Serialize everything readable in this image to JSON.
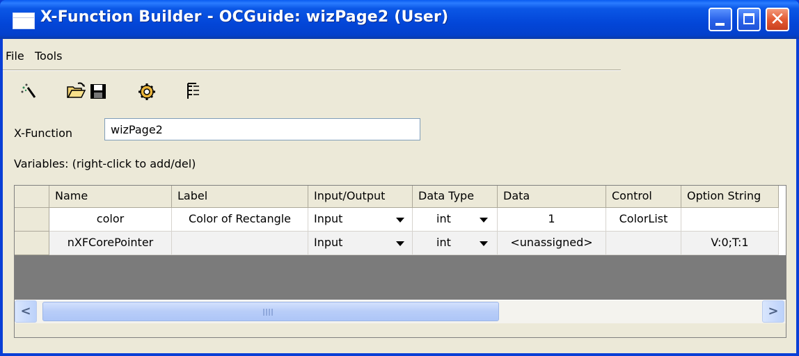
{
  "window": {
    "title": "X-Function Builder - OCGuide: wizPage2 (User)",
    "close_glyph": "✕"
  },
  "menu": {
    "items": [
      "File",
      "Tools"
    ]
  },
  "toolbar": {
    "buttons": [
      "new-wizard-icon",
      "open-folder-icon",
      "save-disk-icon",
      "settings-gear-icon",
      "tree-view-icon"
    ]
  },
  "xfunction": {
    "label": "X-Function",
    "value": "wizPage2"
  },
  "variables": {
    "label": "Variables: (right-click to add/del)"
  },
  "grid": {
    "headers": [
      "Name",
      "Label",
      "Input/Output",
      "Data Type",
      "Data",
      "Control",
      "Option String"
    ],
    "rows": [
      {
        "name": "color",
        "label": "Color of Rectangle",
        "io": "Input",
        "type": "int",
        "data": "1",
        "control": "ColorList",
        "option": ""
      },
      {
        "name": "nXFCorePointer",
        "label": "",
        "io": "Input",
        "type": "int",
        "data": "<unassigned>",
        "control": "",
        "option": "V:0;T:1"
      }
    ]
  },
  "scrollbar": {
    "left_arrow": "<",
    "right_arrow": ">"
  },
  "colors": {
    "title_bar": "#0346d8",
    "client_bg": "#ece9d8",
    "dark_band": "#7b7b7b"
  }
}
